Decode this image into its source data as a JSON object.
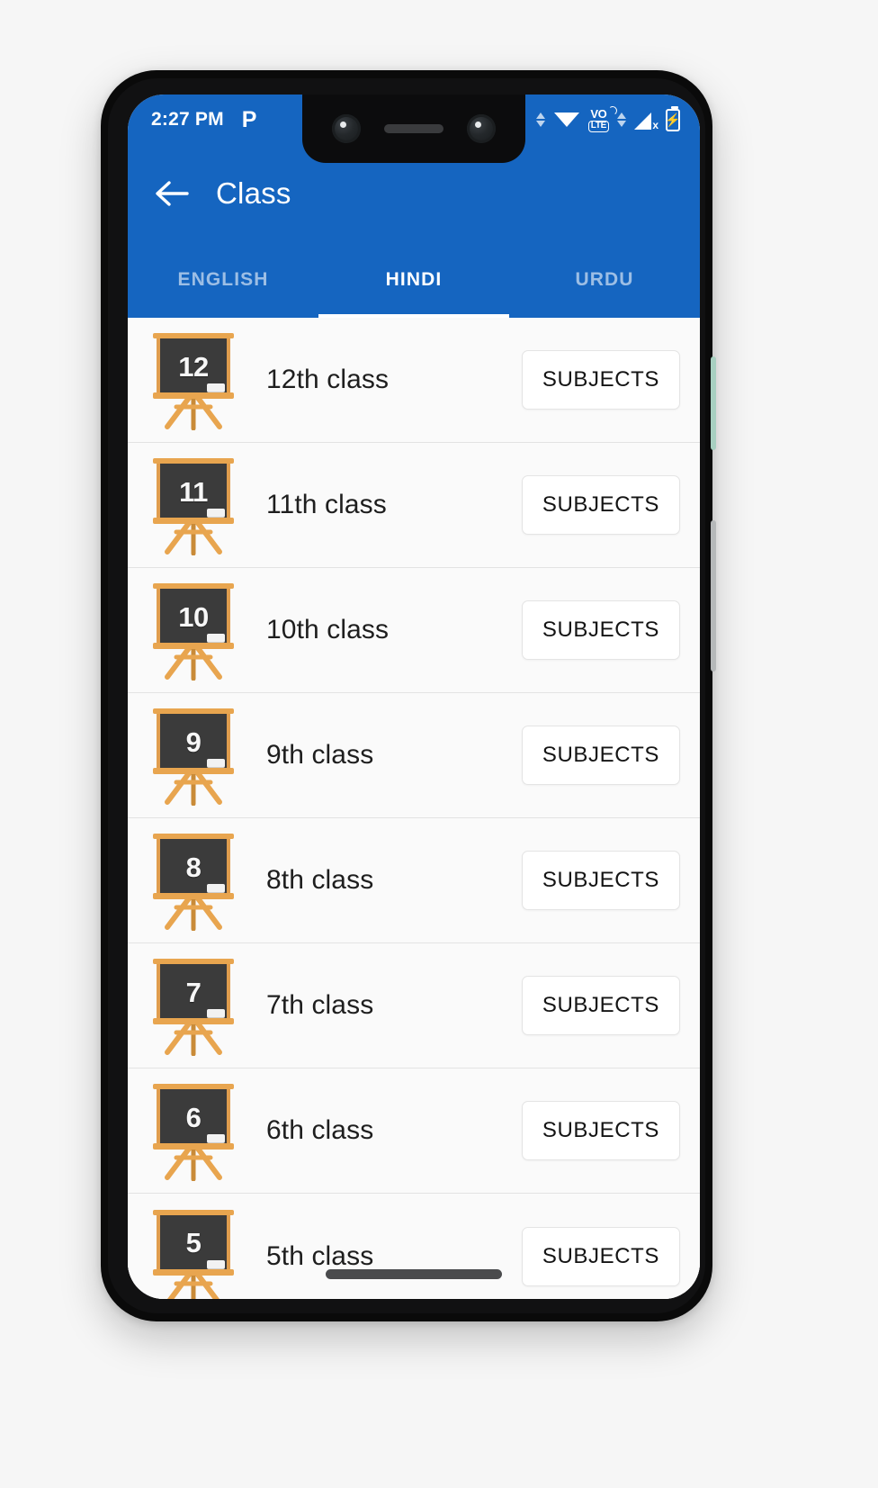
{
  "statusbar": {
    "time": "2:27 PM",
    "app_badge": "P",
    "icons": [
      "data-transfer-arrows-icon",
      "wifi-icon",
      "volte-icon",
      "data-transfer-arrows-icon",
      "cellular-signal-off-icon",
      "battery-charging-icon"
    ],
    "volte_top": "VO",
    "volte_bottom": "LTE",
    "signal_x": "x",
    "battery_bolt": "⚡"
  },
  "appbar": {
    "back_icon": "back-arrow-icon",
    "title": "Class"
  },
  "tabs": [
    {
      "label": "ENGLISH",
      "active": false
    },
    {
      "label": "HINDI",
      "active": true
    },
    {
      "label": "URDU",
      "active": false
    }
  ],
  "list": {
    "action_label": "SUBJECTS",
    "rows": [
      {
        "number": "12",
        "label": "12th class"
      },
      {
        "number": "11",
        "label": "11th class"
      },
      {
        "number": "10",
        "label": "10th class"
      },
      {
        "number": "9",
        "label": "9th class"
      },
      {
        "number": "8",
        "label": "8th class"
      },
      {
        "number": "7",
        "label": "7th class"
      },
      {
        "number": "6",
        "label": "6th class"
      },
      {
        "number": "5",
        "label": "5th class"
      }
    ]
  },
  "colors": {
    "primary": "#1565c0",
    "board_frame": "#e8a54f",
    "board_face": "#3b3b3b",
    "list_background": "#fafafa"
  }
}
